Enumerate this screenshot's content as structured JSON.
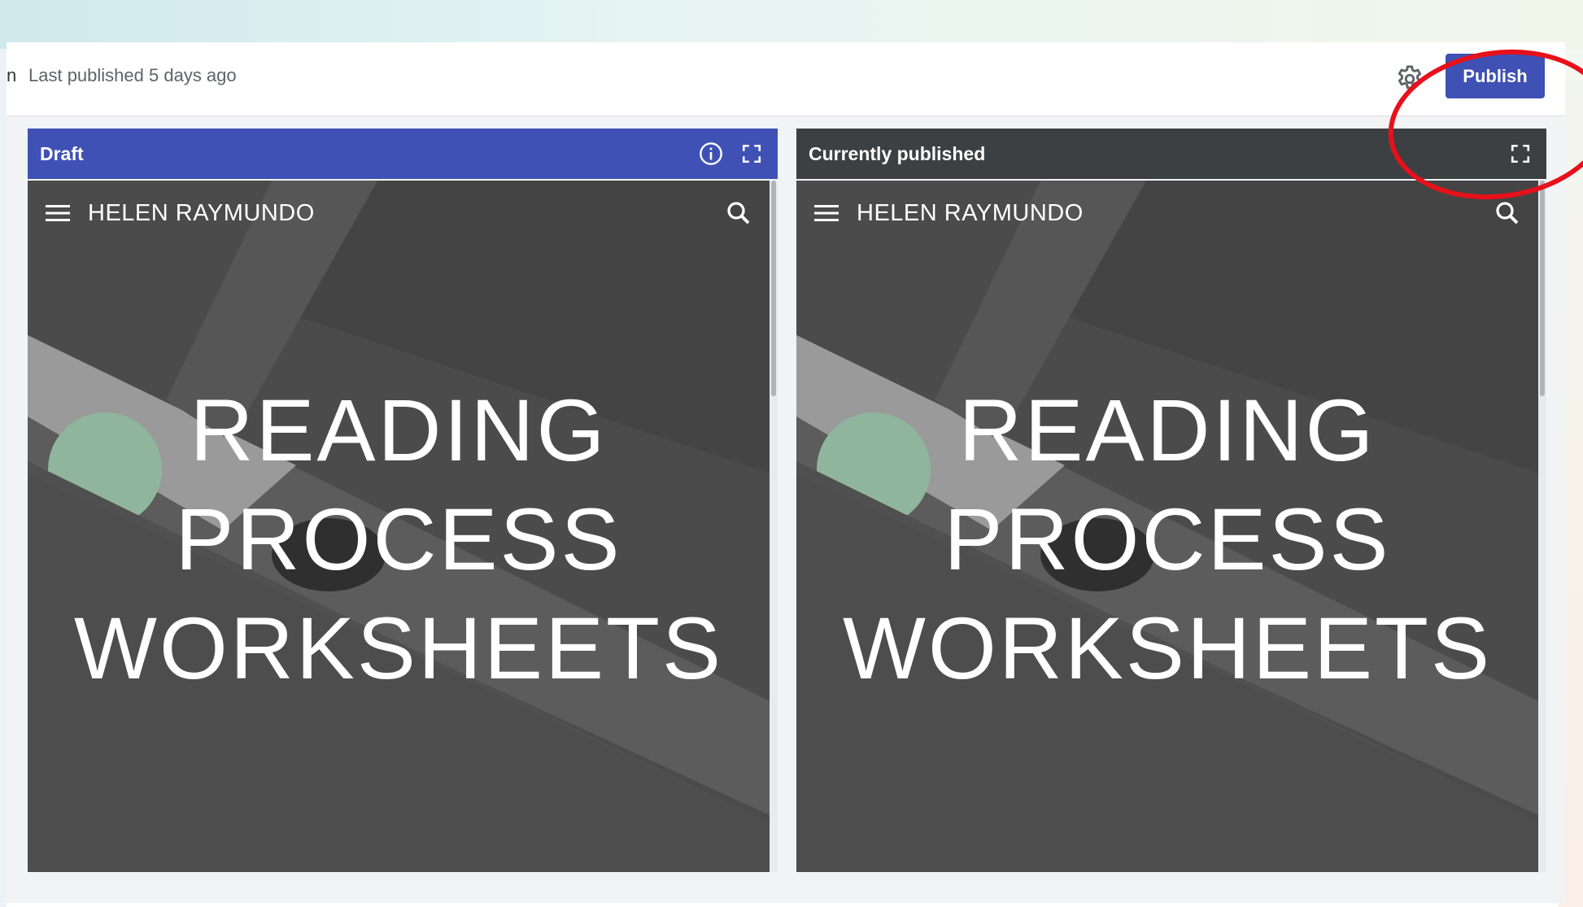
{
  "topbar": {
    "last_published": "Last published 5 days ago",
    "publish_label": "Publish",
    "settings_icon": "gear-icon"
  },
  "panels": [
    {
      "title": "Draft",
      "header_color": "#3f51b5",
      "icons": [
        "info-icon",
        "fullscreen-icon"
      ],
      "site": {
        "name": "HELEN RAYMUNDO",
        "hero_lines": [
          "READING",
          "PROCESS",
          "WORKSHEETS"
        ]
      }
    },
    {
      "title": "Currently published",
      "header_color": "#3c4043",
      "icons": [
        "fullscreen-icon"
      ],
      "site": {
        "name": "HELEN RAYMUNDO",
        "hero_lines": [
          "READING",
          "PROCESS",
          "WORKSHEETS"
        ]
      }
    }
  ],
  "colors": {
    "accent": "#3f51b5",
    "highlight_circle": "#e8101a",
    "footer_bar": "#1b5e20"
  }
}
